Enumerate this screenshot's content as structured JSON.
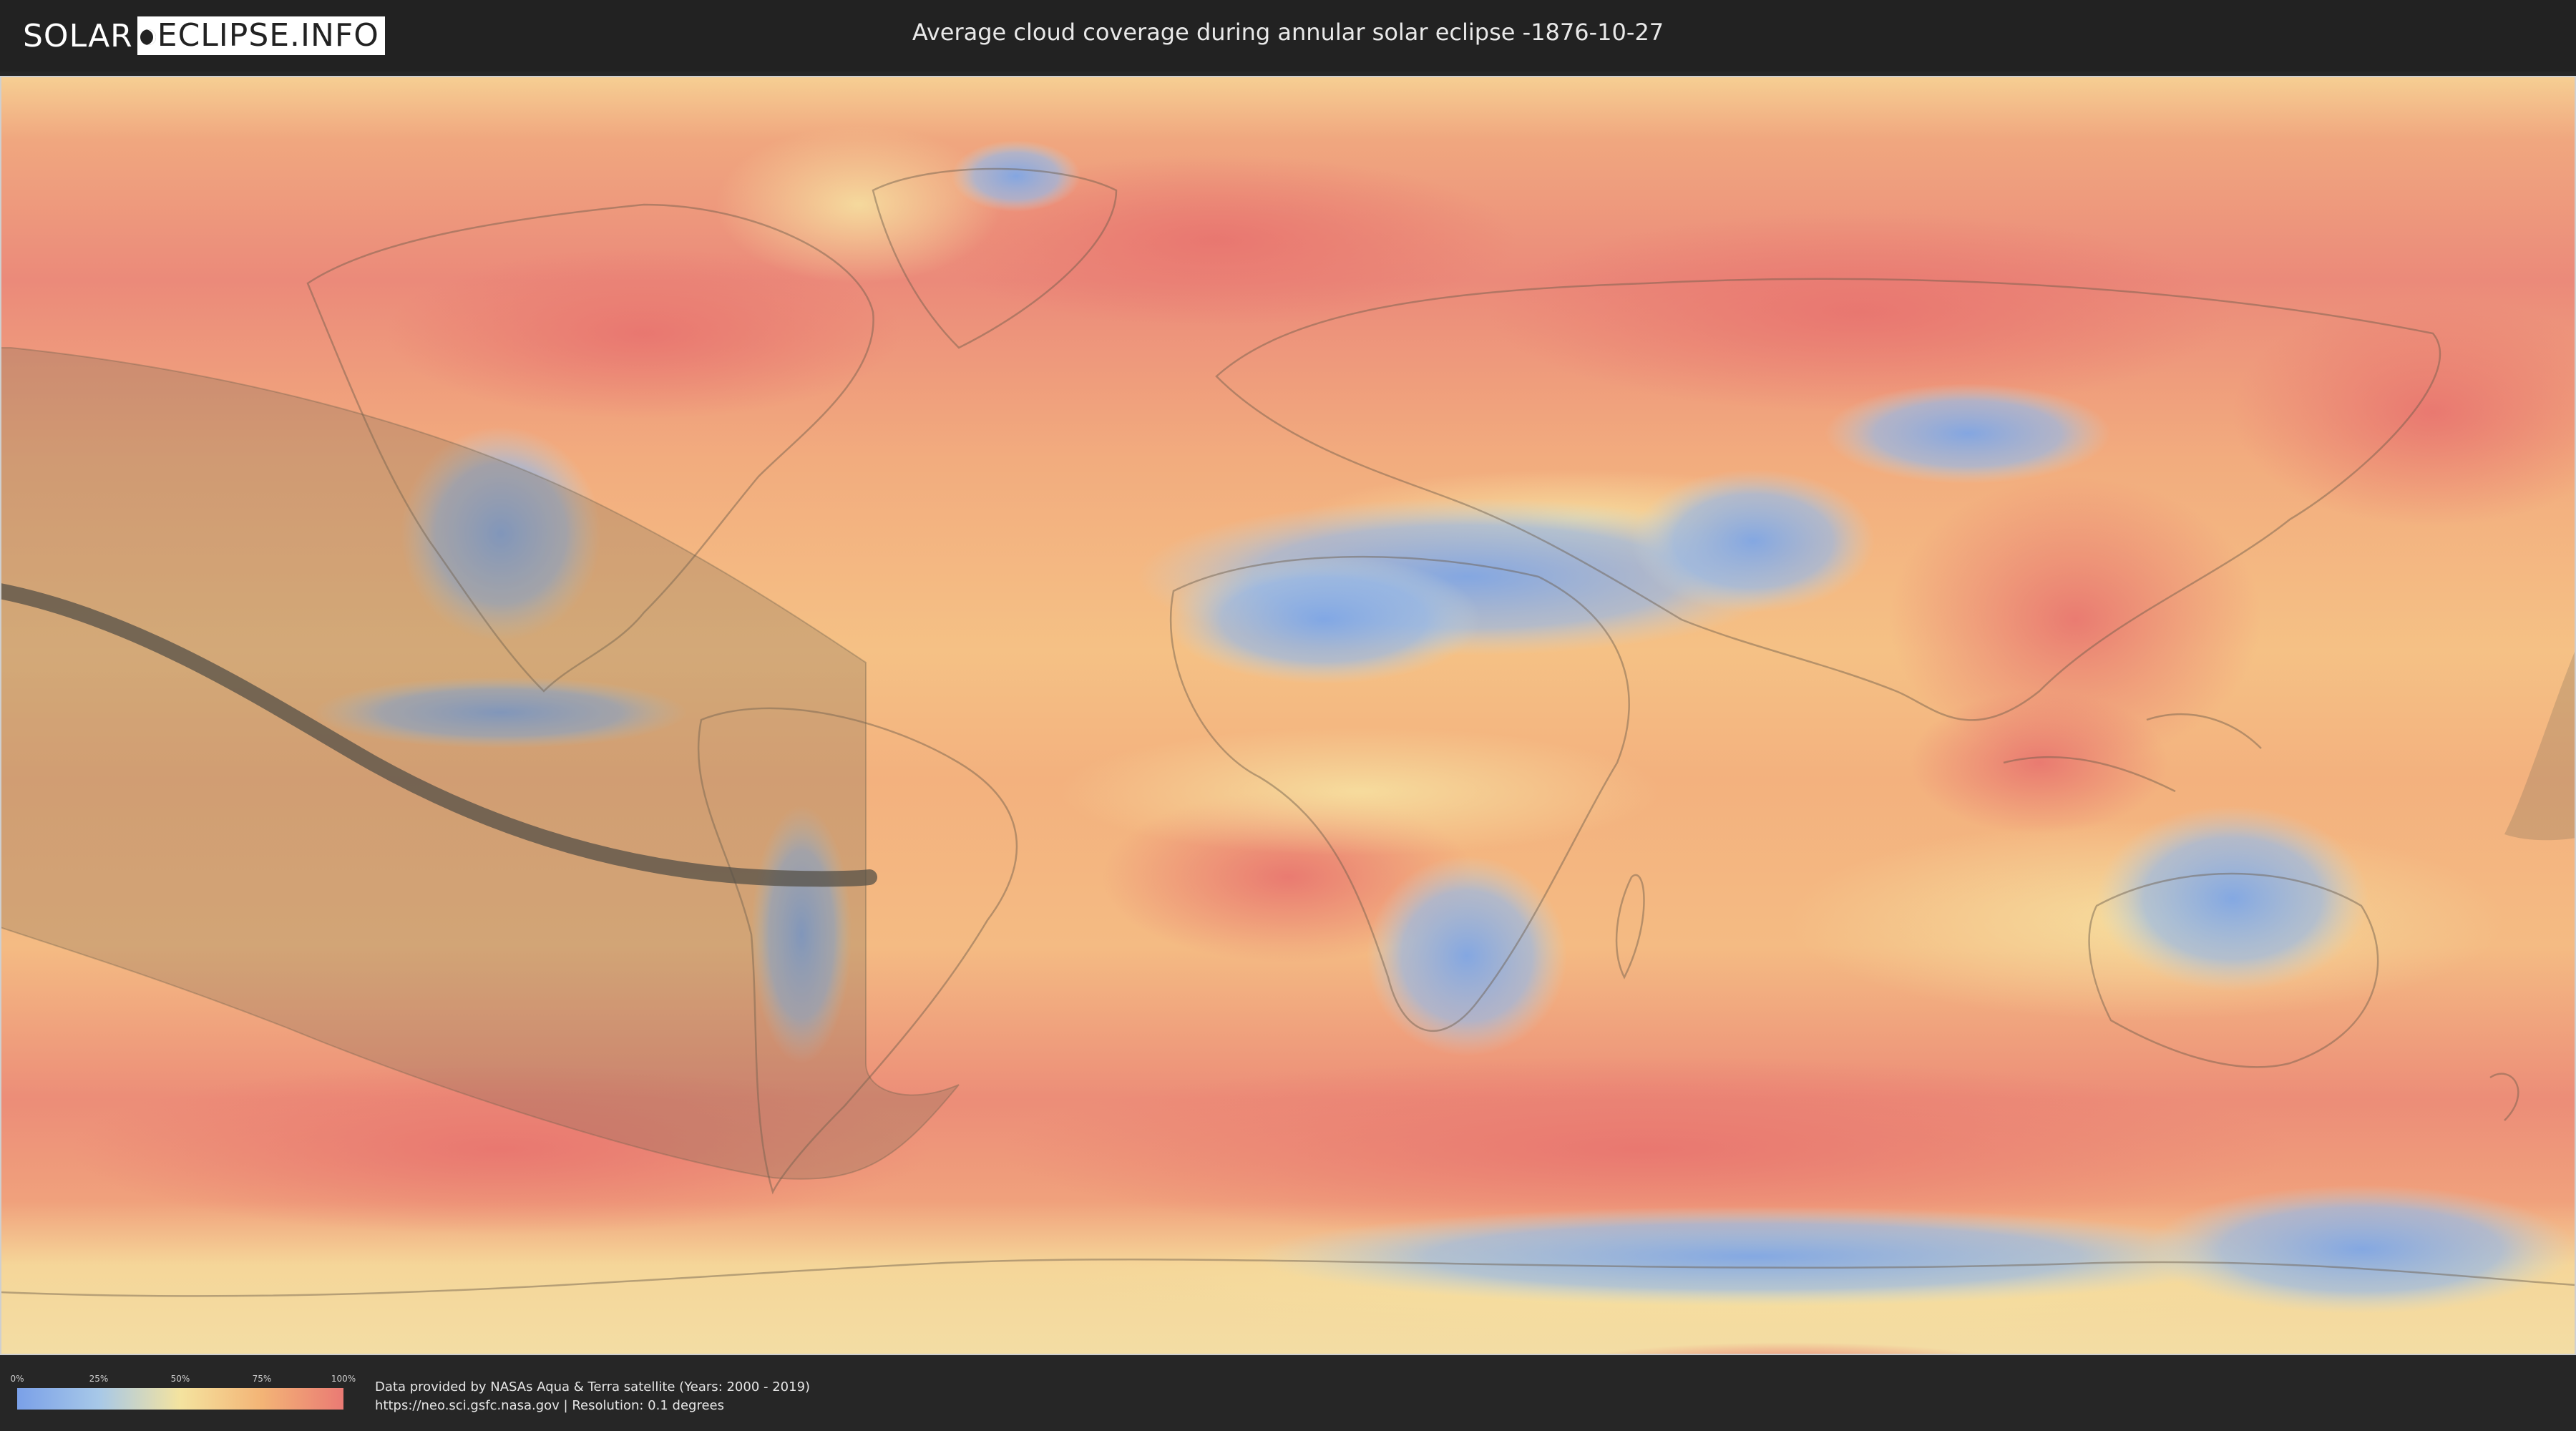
{
  "header": {
    "logo_solar": "SOLAR",
    "logo_eclipse": "ECLIPSE.INFO",
    "title": "Average cloud coverage during annular solar eclipse -1876-10-27"
  },
  "legend": {
    "labels": [
      "0%",
      "25%",
      "50%",
      "75%",
      "100%"
    ],
    "colors": [
      "#7aa0e8",
      "#a7c8e8",
      "#f4e39f",
      "#f3b476",
      "#ea7a74"
    ]
  },
  "credits": {
    "line1": "Data provided by NASAs Aqua & Terra satellite (Years: 2000 - 2019)",
    "line2": "https://neo.sci.gsfc.nasa.gov | Resolution: 0.1 degrees"
  },
  "map": {
    "icons": [
      "cloud-coverage-layer",
      "eclipse-shadow-band",
      "eclipse-central-line"
    ]
  }
}
